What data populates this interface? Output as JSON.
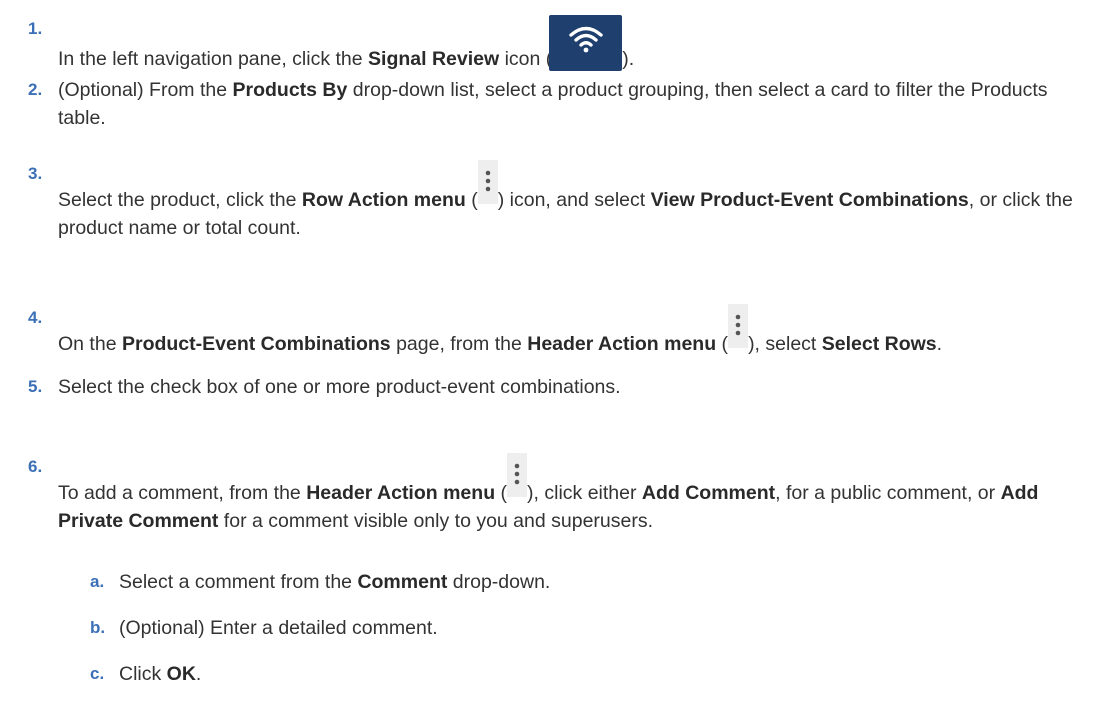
{
  "steps": [
    {
      "num": "1.",
      "parts": {
        "a": "In the left navigation pane, click the ",
        "b": "Signal Review",
        "c": " icon (",
        "d": ")."
      }
    },
    {
      "num": "2.",
      "parts": {
        "a": "(Optional) From the ",
        "b": "Products By",
        "c": " drop-down list, select a product grouping, then select a card to filter the Products table."
      }
    },
    {
      "num": "3.",
      "parts": {
        "a": "Select the product, click the ",
        "b": "Row Action menu",
        "c": " (",
        "d": ") icon, and select ",
        "e": "View Product-Event Combinations",
        "f": ", or click the product name or total count."
      }
    },
    {
      "num": "4.",
      "parts": {
        "a": "On the ",
        "b": "Product-Event Combinations",
        "c": " page, from the ",
        "d": "Header Action menu",
        "e": " (",
        "f": "), select ",
        "g": "Select Rows",
        "h": "."
      }
    },
    {
      "num": "5.",
      "parts": {
        "a": "Select the check box of one or more product-event combinations."
      }
    },
    {
      "num": "6.",
      "parts": {
        "a": "To add a comment, from the ",
        "b": "Header Action menu",
        "c": " (",
        "d": "), click either ",
        "e": "Add Comment",
        "f": ", for a public comment, or ",
        "g": "Add Private Comment",
        "h": " for a comment visible only to you and superusers."
      }
    }
  ],
  "substeps": [
    {
      "num": "a.",
      "parts": {
        "a": "Select a comment from the ",
        "b": "Comment",
        "c": " drop-down."
      }
    },
    {
      "num": "b.",
      "parts": {
        "a": "(Optional) Enter a detailed comment."
      }
    },
    {
      "num": "c.",
      "parts": {
        "a": "Click ",
        "b": "OK",
        "c": "."
      }
    }
  ],
  "icons": {
    "signal_review": "wifi-icon",
    "row_action": "kebab-menu-icon",
    "header_action": "kebab-menu-icon"
  },
  "colors": {
    "step_number": "#3b6fb6",
    "icon_background": "#1f3f6e"
  }
}
